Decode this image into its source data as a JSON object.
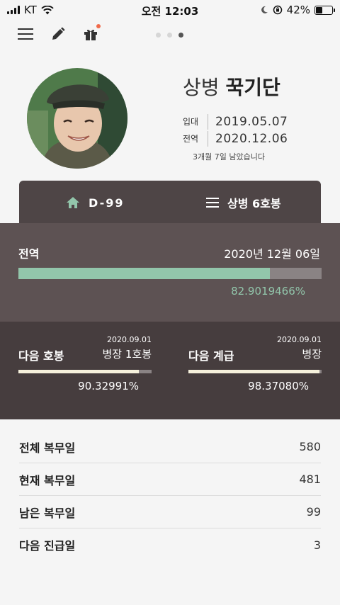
{
  "status_bar": {
    "carrier": "KT",
    "time": "오전 12:03",
    "battery": "42%",
    "battery_level": 0.42
  },
  "toolbar": {
    "icons": [
      "menu-icon",
      "pencil-icon",
      "gift-icon"
    ]
  },
  "pager": {
    "count": 3,
    "active_index": 2
  },
  "profile": {
    "rank": "상병",
    "name": "꾹기단",
    "enlist_label": "입대",
    "enlist_date": "2019.05.07",
    "discharge_label": "전역",
    "discharge_date": "2020.12.06",
    "remaining_text": "3개월 7일 남았습니다"
  },
  "summary_card": {
    "dday": "D-99",
    "rank_step": "상병 6호봉"
  },
  "discharge_progress": {
    "label": "전역",
    "date": "2020년 12월 06일",
    "percent_text": "82.9019466%",
    "fraction": 0.829019466,
    "fill_color": "#92c6ab"
  },
  "next_step": {
    "date": "2020.09.01",
    "label": "다음 호봉",
    "target": "병장 1호봉",
    "percent_text": "90.32991%",
    "fraction": 0.9032991
  },
  "next_rank": {
    "date": "2020.09.01",
    "label": "다음 계급",
    "target": "병장",
    "percent_text": "98.37080%",
    "fraction": 0.983708
  },
  "stats": [
    {
      "label": "전체 복무일",
      "value": "580"
    },
    {
      "label": "현재 복무일",
      "value": "481"
    },
    {
      "label": "남은 복무일",
      "value": "99"
    },
    {
      "label": "다음 진급일",
      "value": "3"
    }
  ]
}
